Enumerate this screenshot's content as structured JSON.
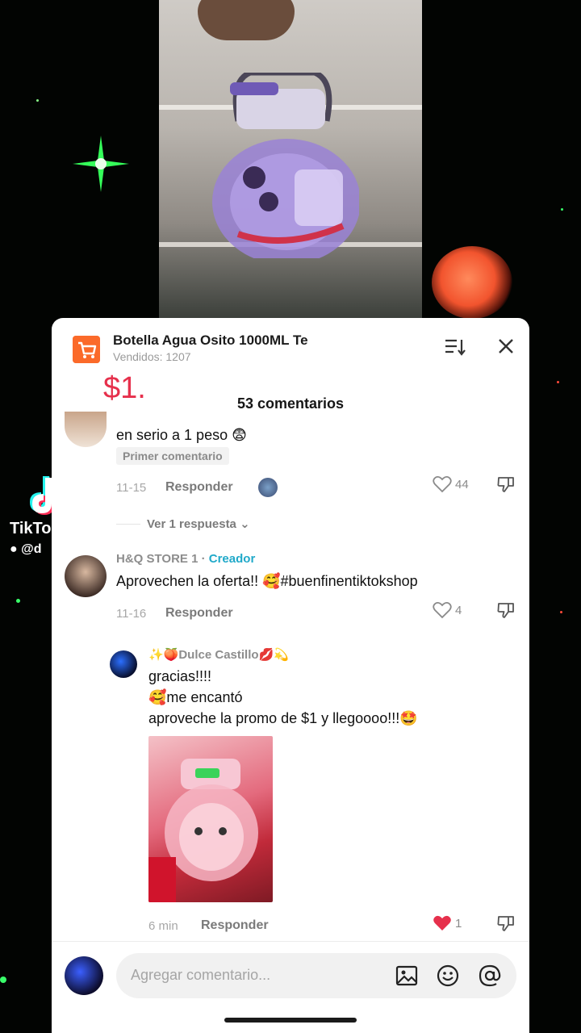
{
  "watermark": {
    "brand": "TikTok",
    "user": "@d"
  },
  "product": {
    "title": "Botella Agua Osito 1000ML Te",
    "sold": "Vendidos: 1207",
    "price": "$1."
  },
  "comments_header": {
    "count": "53 comentarios"
  },
  "comments": [
    {
      "text": "en serio a 1 peso 😨",
      "badge": "Primer comentario",
      "date": "11-15",
      "reply": "Responder",
      "likes": "44",
      "view_replies": "Ver 1 respuesta ⌄"
    },
    {
      "username": "H&Q STORE 1",
      "sep": " · ",
      "role": "Creador",
      "text": "Aprovechen la oferta!! 🥰#buenfinentiktokshop",
      "date": "11-16",
      "reply": "Responder",
      "likes": "4"
    },
    {
      "username": "✨🍑Dulce Castillo💋💫",
      "line1": "gracias!!!!",
      "line2": "🥰me encantó",
      "line3": "aproveche la promo de $1 y llegoooo!!!🤩",
      "date": "6 min",
      "reply": "Responder",
      "likes": "1"
    }
  ],
  "input": {
    "placeholder": "Agregar comentario..."
  },
  "colors": {
    "accent_red": "#e6304c",
    "creator": "#20a9c9",
    "cart": "#fb6a2a"
  }
}
